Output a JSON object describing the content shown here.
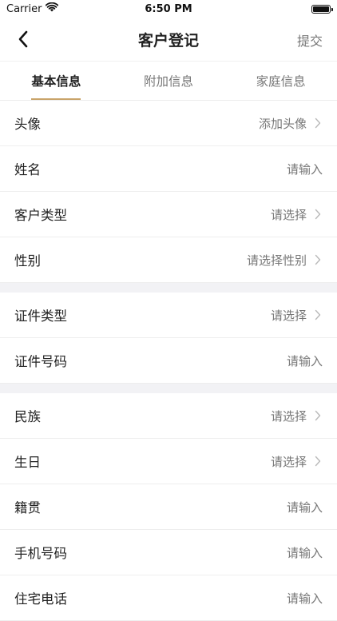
{
  "status": {
    "carrier": "Carrier",
    "time": "6:50 PM"
  },
  "nav": {
    "title": "客户登记",
    "action": "提交"
  },
  "tabs": [
    {
      "label": "基本信息",
      "active": true
    },
    {
      "label": "附加信息",
      "active": false
    },
    {
      "label": "家庭信息",
      "active": false
    }
  ],
  "groups": [
    [
      {
        "label": "头像",
        "value": "添加头像",
        "chevron": true
      },
      {
        "label": "姓名",
        "value": "请输入",
        "chevron": false
      },
      {
        "label": "客户类型",
        "value": "请选择",
        "chevron": true
      },
      {
        "label": "性别",
        "value": "请选择性别",
        "chevron": true
      }
    ],
    [
      {
        "label": "证件类型",
        "value": "请选择",
        "chevron": true
      },
      {
        "label": "证件号码",
        "value": "请输入",
        "chevron": false
      }
    ],
    [
      {
        "label": "民族",
        "value": "请选择",
        "chevron": true
      },
      {
        "label": "生日",
        "value": "请选择",
        "chevron": true
      },
      {
        "label": "籍贯",
        "value": "请输入",
        "chevron": false
      },
      {
        "label": "手机号码",
        "value": "请输入",
        "chevron": false
      },
      {
        "label": "住宅电话",
        "value": "请输入",
        "chevron": false
      }
    ]
  ],
  "colors": {
    "accent": "#c9a46a",
    "section_gap": "#f2f2f5"
  }
}
